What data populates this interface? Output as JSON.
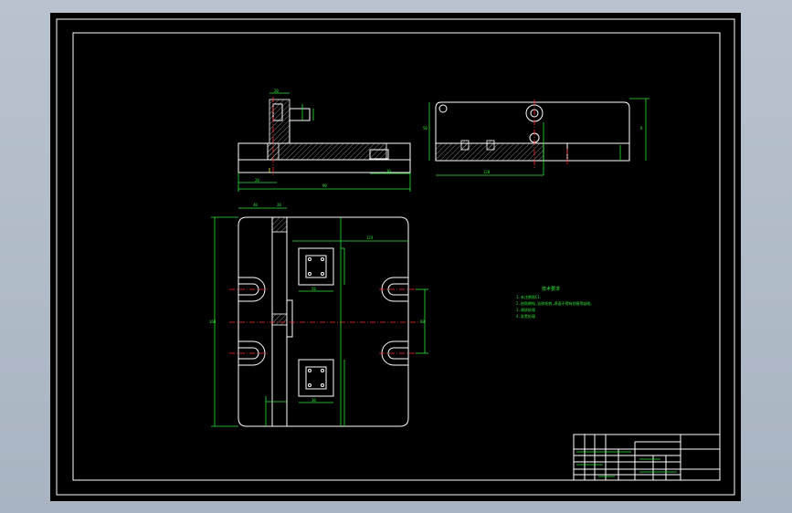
{
  "drawing": {
    "background": "#000000",
    "frame_color": "#ffffff",
    "dimension_color": "#2fe83a",
    "centerline_color": "#ff2a2a",
    "note_title": "技术要求",
    "notes": [
      "1.未注倒角C1.",
      "2.锐角倒钝,去除毛刺,表面不得有划痕等缺陷.",
      "3.调质处理.",
      "4.发黑处理."
    ],
    "dimensions": {
      "top_total": "90",
      "top_left": "20",
      "top_right": "30",
      "side_left": "50",
      "side_total": "120",
      "plan_top_a": "40",
      "plan_top_b": "20",
      "plan_width": "124",
      "plan_height": "160",
      "plan_center": "60",
      "pocket_a": "50",
      "pocket_b": "30",
      "small_a": "20",
      "small_b": "8"
    }
  }
}
